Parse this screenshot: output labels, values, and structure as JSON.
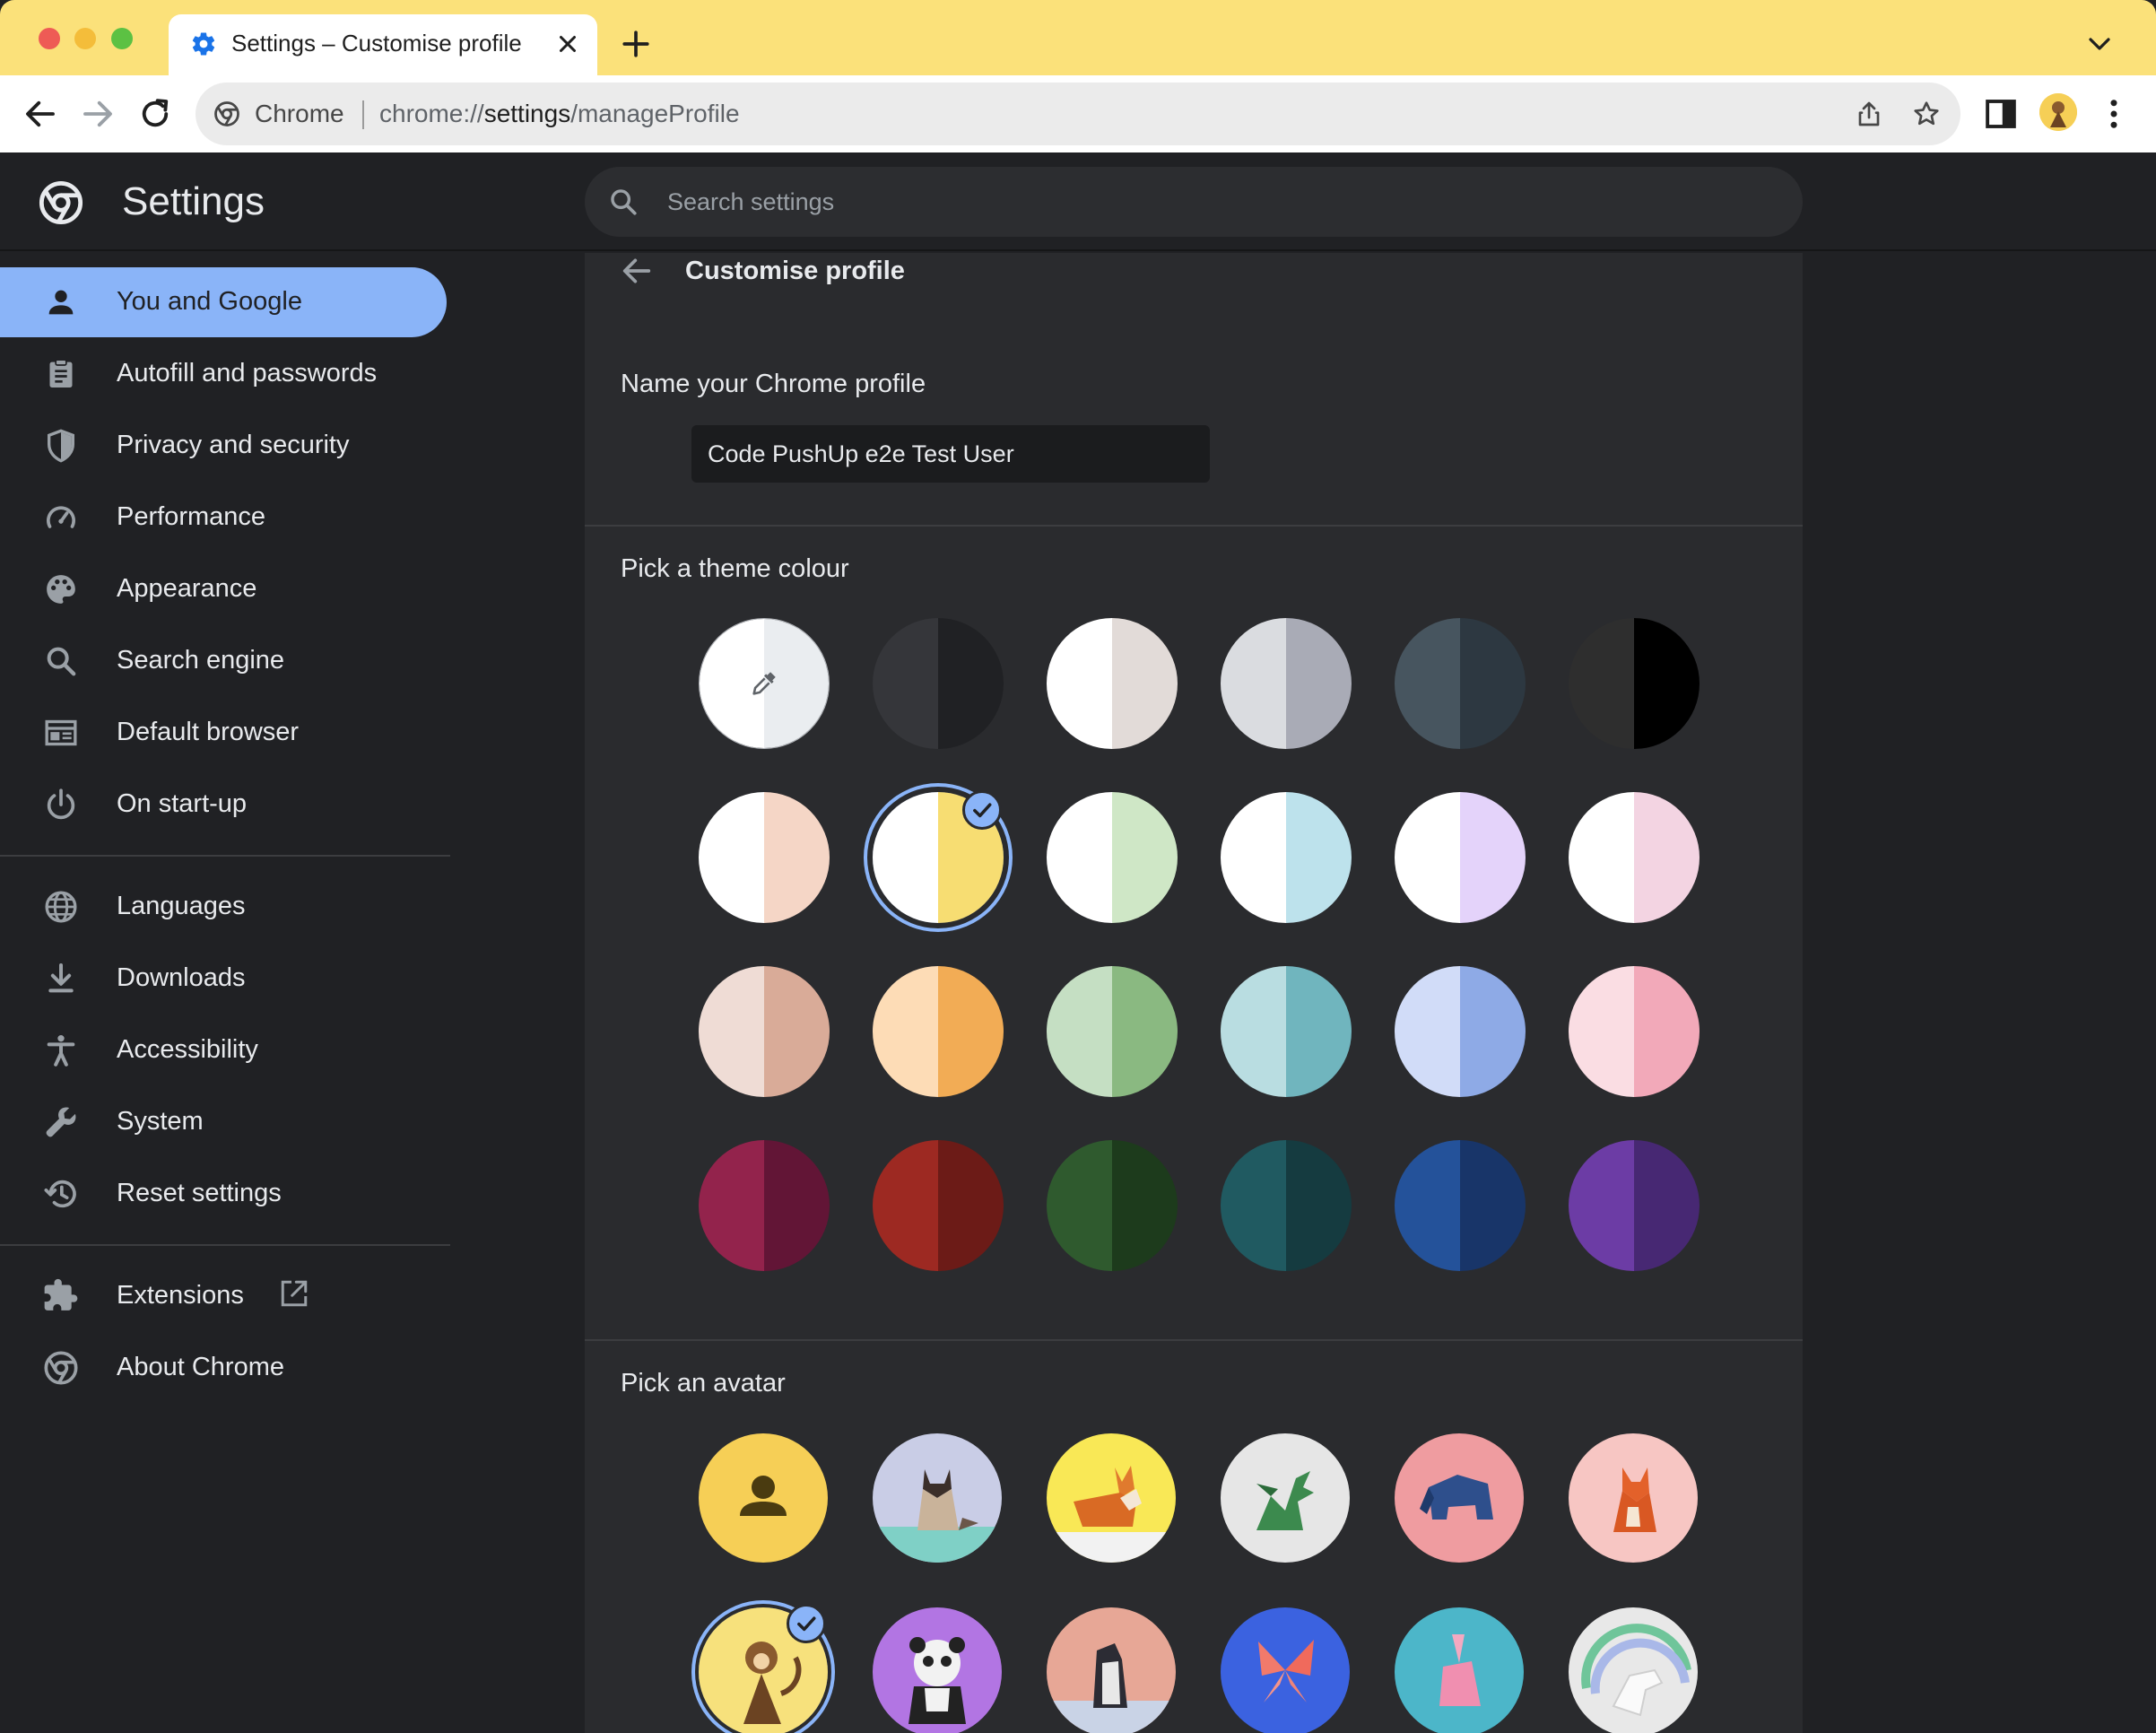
{
  "browser": {
    "tab_title": "Settings – Customise profile",
    "omnibox_site": "Chrome",
    "url_scheme": "chrome://",
    "url_host": "settings",
    "url_path": "/manageProfile"
  },
  "header": {
    "title": "Settings",
    "search_placeholder": "Search settings"
  },
  "sidebar": {
    "items": [
      {
        "label": "You and Google",
        "icon": "person-icon",
        "active": true
      },
      {
        "label": "Autofill and passwords",
        "icon": "clipboard-icon"
      },
      {
        "label": "Privacy and security",
        "icon": "shield-icon"
      },
      {
        "label": "Performance",
        "icon": "speedometer-icon"
      },
      {
        "label": "Appearance",
        "icon": "palette-icon"
      },
      {
        "label": "Search engine",
        "icon": "search-icon"
      },
      {
        "label": "Default browser",
        "icon": "browser-window-icon"
      },
      {
        "label": "On start-up",
        "icon": "power-icon"
      },
      {
        "label": "Languages",
        "icon": "globe-icon"
      },
      {
        "label": "Downloads",
        "icon": "download-icon"
      },
      {
        "label": "Accessibility",
        "icon": "accessibility-icon"
      },
      {
        "label": "System",
        "icon": "wrench-icon"
      },
      {
        "label": "Reset settings",
        "icon": "history-icon"
      },
      {
        "label": "Extensions",
        "icon": "puzzle-icon"
      },
      {
        "label": "About Chrome",
        "icon": "chrome-icon"
      }
    ]
  },
  "main": {
    "page_title": "Customise profile",
    "name_section_label": "Name your Chrome profile",
    "profile_name": "Code PushUp e2e Test User",
    "theme_section_label": "Pick a theme colour",
    "avatar_section_label": "Pick an avatar",
    "theme_colours": [
      [
        "#ffffff",
        "#eaedf0"
      ],
      [
        "#35363a",
        "#202124"
      ],
      [
        "#ffffff",
        "#e2dbd8"
      ],
      [
        "#dadce0",
        "#a9abb6"
      ],
      [
        "#47555f",
        "#2d3841"
      ],
      [
        "#2e2e2e",
        "#000000"
      ],
      [
        "#ffffff",
        "#f5d6c6"
      ],
      [
        "#ffffff",
        "#f7dd72"
      ],
      [
        "#ffffff",
        "#cfe7c6"
      ],
      [
        "#ffffff",
        "#bde2ec"
      ],
      [
        "#ffffff",
        "#e4d3fa"
      ],
      [
        "#ffffff",
        "#f3d4e2"
      ],
      [
        "#efdcd5",
        "#d9ab98"
      ],
      [
        "#fddcb6",
        "#f2ac55"
      ],
      [
        "#c5dfc3",
        "#8ab981"
      ],
      [
        "#b9dde1",
        "#70b5be"
      ],
      [
        "#d1dcf8",
        "#8eaae6"
      ],
      [
        "#fadde3",
        "#f2a9b9"
      ],
      [
        "#93234c",
        "#621536"
      ],
      [
        "#9d2922",
        "#6c1b17"
      ],
      [
        "#2f5a2e",
        "#1d3b1c"
      ],
      [
        "#205a61",
        "#153b40"
      ],
      [
        "#24529a",
        "#183569"
      ],
      [
        "#6c3ca5",
        "#472873"
      ]
    ],
    "selected_theme_index": 7,
    "avatars": [
      {
        "name": "generic-person",
        "bg": "#f6cf56"
      },
      {
        "name": "cat",
        "bg": "#c9cde6"
      },
      {
        "name": "corgi",
        "bg": "#f9e856"
      },
      {
        "name": "dragon",
        "bg": "#e6e6e6"
      },
      {
        "name": "elephant",
        "bg": "#ef9ca0"
      },
      {
        "name": "fox",
        "bg": "#f7c6c3"
      },
      {
        "name": "monkey",
        "bg": "#f7e17c",
        "selected": true
      },
      {
        "name": "panda",
        "bg": "#b275e3"
      },
      {
        "name": "penguin",
        "bg": "#e7a796"
      },
      {
        "name": "butterfly",
        "bg": "#3b62e0"
      },
      {
        "name": "rabbit",
        "bg": "#4cb6c9"
      },
      {
        "name": "unicorn",
        "bg": "#e8e8e8"
      }
    ]
  },
  "colors": {
    "accent": "#8ab4f8",
    "background": "#202124",
    "card": "#2a2b2e",
    "tabstrip": "#fbe17a"
  }
}
